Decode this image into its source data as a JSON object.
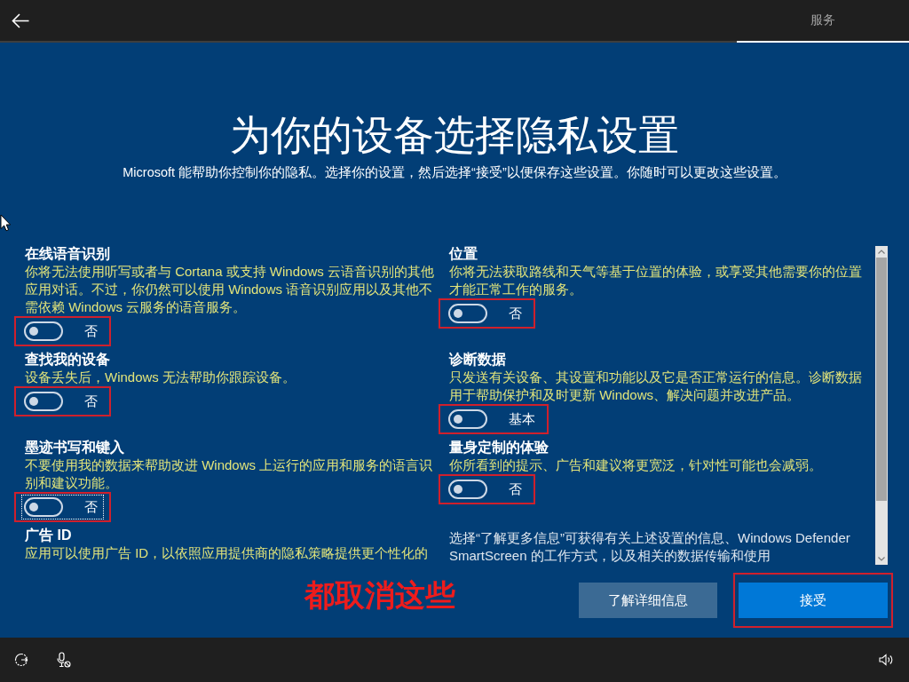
{
  "tabs": [
    {
      "label": "服务",
      "selected": true
    }
  ],
  "title": "为你的设备选择隐私设置",
  "subtitle": "Microsoft 能帮助你控制你的隐私。选择你的设置，然后选择“接受”以便保存这些设置。你随时可以更改这些设置。",
  "left_column": [
    {
      "kind": "setting",
      "heading": "在线语音识别",
      "description": "你将无法使用听写或者与 Cortana 或支持 Windows 云语音识别的其他应用对话。不过，你仍然可以使用 Windows 语音识别应用以及其他不需依赖 Windows 云服务的语音服务。",
      "on": false,
      "state_label": "否",
      "annotated": true,
      "focused": false
    },
    {
      "kind": "setting",
      "heading": "查找我的设备",
      "description": "设备丢失后，Windows 无法帮助你跟踪设备。",
      "on": false,
      "state_label": "否",
      "annotated": true,
      "focused": false
    },
    {
      "kind": "setting",
      "heading": "墨迹书写和键入",
      "description": "不要使用我的数据来帮助改进 Windows 上运行的应用和服务的语言识别和建议功能。",
      "on": false,
      "state_label": "否",
      "annotated": true,
      "focused": true
    },
    {
      "kind": "setting",
      "heading": "广告 ID",
      "description": "应用可以使用广告 ID，以依照应用提供商的隐私策略提供更个性化的"
    }
  ],
  "right_column": [
    {
      "kind": "setting",
      "heading": "位置",
      "description": "你将无法获取路线和天气等基于位置的体验，或享受其他需要你的位置才能正常工作的服务。",
      "on": false,
      "state_label": "否",
      "annotated": true,
      "focused": false
    },
    {
      "kind": "setting",
      "heading": "诊断数据",
      "description": "只发送有关设备、其设置和功能以及它是否正常运行的信息。诊断数据用于帮助保护和及时更新 Windows、解决问题并改进产品。",
      "on": false,
      "state_label": "基本",
      "annotated": true,
      "focused": false
    },
    {
      "kind": "setting",
      "heading": "量身定制的体验",
      "description": "你所看到的提示、广告和建议将更宽泛，针对性可能也会减弱。",
      "on": false,
      "state_label": "否",
      "annotated": true,
      "focused": false
    },
    {
      "kind": "note",
      "text": "选择“了解更多信息”可获得有关上述设置的信息、Windows Defender SmartScreen 的工作方式，以及相关的数据传输和使用"
    }
  ],
  "annotation_note": "都取消这些",
  "buttons": [
    {
      "label": "了解详细信息",
      "kind": "secondary",
      "annotated": false
    },
    {
      "label": "接受",
      "kind": "primary",
      "annotated": true
    }
  ]
}
